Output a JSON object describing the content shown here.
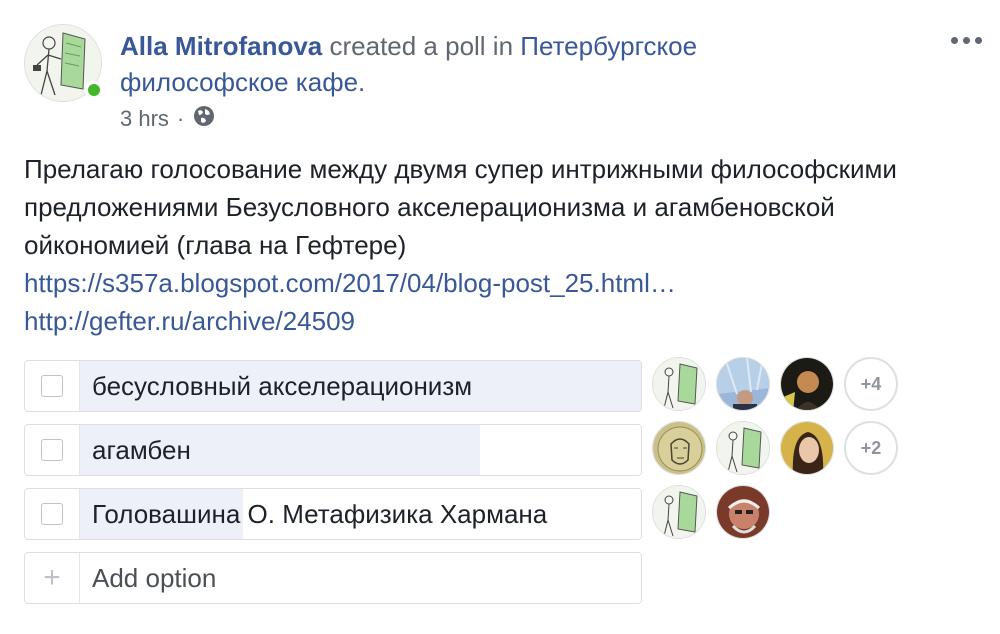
{
  "post": {
    "author": "Alla Mitrofanova",
    "action_text": "created a poll in",
    "group": "Петербургское философское кафе.",
    "timestamp": "3 hrs",
    "separator": "·",
    "privacy_icon": "globe-icon",
    "more_icon": "more-options-icon",
    "text": "Прелагаю голосование между двумя супер интрижными философскими предложениями Безусловного акселерационизма и агамбеновской ойкономией (глава на Гефтере)",
    "link1": "https://s357a.blogspot.com/2017/04/blog-post_25.html…",
    "link2": "http://gefter.ru/archive/24509"
  },
  "poll": {
    "options": [
      {
        "label": "бесусловный акселерационизм",
        "vote_fraction": 1.0,
        "more_voters": "+4"
      },
      {
        "label": "агамбен",
        "vote_fraction": 0.71,
        "more_voters": "+2"
      },
      {
        "label": "Головашина О. Метафизика Хармана",
        "vote_fraction": 0.29,
        "more_voters": ""
      }
    ],
    "add_option_placeholder": "Add option",
    "add_icon": "plus-icon"
  },
  "colors": {
    "link": "#385898",
    "online": "#42b72a",
    "poll_fill": "#eef0f7",
    "text": "#1d2129",
    "muted": "#606770"
  }
}
